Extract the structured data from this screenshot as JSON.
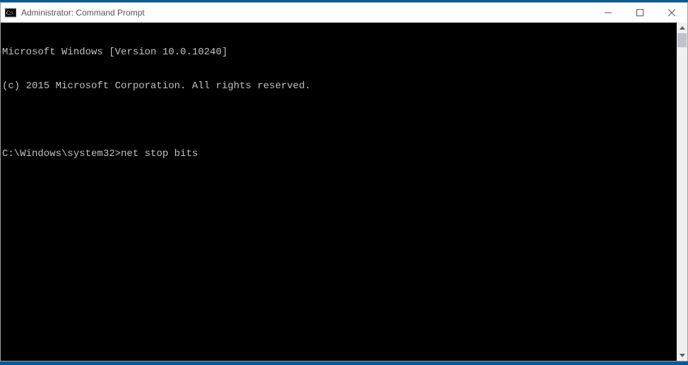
{
  "window": {
    "title": "Administrator: Command Prompt"
  },
  "terminal": {
    "lines": [
      "Microsoft Windows [Version 10.0.10240]",
      "(c) 2015 Microsoft Corporation. All rights reserved.",
      "",
      ""
    ],
    "prompt": "C:\\Windows\\system32>",
    "command": "net stop bits"
  }
}
